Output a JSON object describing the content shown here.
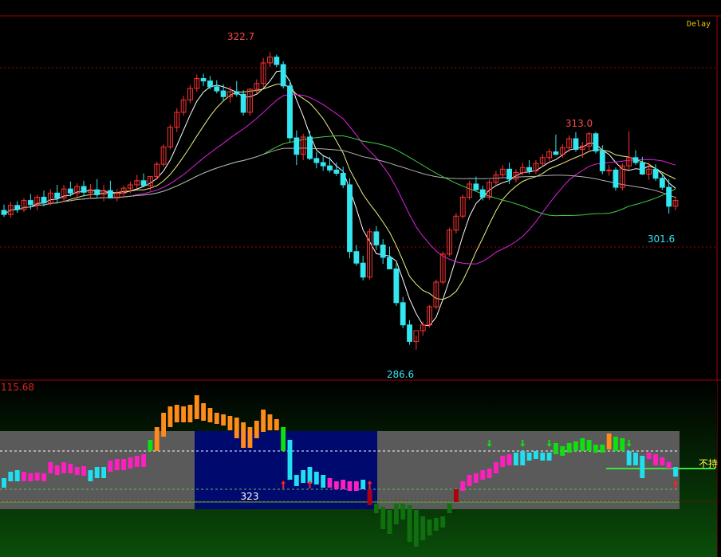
{
  "status": {
    "delay_label": "Delay"
  },
  "colors": {
    "background": "#000000",
    "frame": "#a00000",
    "grid": "#b00000",
    "up": "#ff3232",
    "down": "#33e6f0",
    "ma_white": "#ffffff",
    "ma_yellow": "#f0f080",
    "ma_magenta": "#e020e0",
    "ma_green": "#40d040",
    "ma_gray": "#b0b0b0",
    "ind_orange": "#ff8c1a",
    "ind_magenta": "#ff1fbf",
    "ind_cyan": "#20e0f0",
    "ind_green": "#10e010",
    "ind_darkgreen": "#107010",
    "ind_red": "#b00010",
    "band_gray": "#5a5a5a",
    "band_navy": "#000a6e",
    "label_yellow": "#ffff40"
  },
  "price_panel": {
    "high_label": "322.7",
    "low_label": "286.6",
    "local_high_label": "313.0",
    "last_low_label": "301.6",
    "y_range": [
      283,
      327
    ]
  },
  "indicator_panel": {
    "top_value_label": "115.68",
    "band_value_label": "323",
    "side_label": "不持"
  },
  "chart_data": {
    "type": "candlestick",
    "ylim": [
      283,
      327
    ],
    "candles": [
      [
        303.5,
        304.2,
        302.7,
        303.0
      ],
      [
        303.0,
        304.5,
        302.6,
        304.1
      ],
      [
        304.1,
        304.6,
        303.2,
        303.6
      ],
      [
        303.6,
        305.0,
        303.3,
        304.7
      ],
      [
        304.7,
        305.5,
        303.6,
        304.2
      ],
      [
        304.2,
        305.4,
        303.5,
        305.1
      ],
      [
        305.1,
        305.9,
        304.0,
        304.4
      ],
      [
        304.4,
        306.1,
        304.1,
        305.6
      ],
      [
        305.6,
        306.6,
        304.4,
        305.0
      ],
      [
        305.0,
        306.6,
        304.5,
        306.1
      ],
      [
        306.1,
        307.0,
        305.2,
        305.6
      ],
      [
        305.6,
        306.8,
        304.9,
        306.4
      ],
      [
        306.4,
        307.1,
        305.2,
        305.7
      ],
      [
        305.7,
        306.7,
        305.0,
        306.0
      ],
      [
        306.0,
        307.3,
        305.0,
        305.4
      ],
      [
        305.4,
        306.6,
        304.6,
        305.9
      ],
      [
        305.9,
        307.1,
        305.2,
        305.0
      ],
      [
        305.0,
        306.1,
        304.6,
        305.6
      ],
      [
        305.6,
        306.5,
        305.0,
        306.2
      ],
      [
        306.2,
        307.0,
        305.6,
        306.6
      ],
      [
        306.6,
        307.8,
        306.2,
        307.1
      ],
      [
        307.1,
        308.0,
        306.6,
        306.5
      ],
      [
        306.5,
        307.6,
        305.9,
        307.6
      ],
      [
        307.6,
        309.4,
        307.2,
        309.1
      ],
      [
        309.1,
        311.5,
        308.8,
        311.2
      ],
      [
        311.2,
        313.9,
        310.9,
        313.6
      ],
      [
        313.6,
        315.9,
        313.0,
        315.4
      ],
      [
        315.4,
        317.4,
        315.0,
        316.9
      ],
      [
        316.9,
        318.7,
        316.5,
        318.3
      ],
      [
        318.3,
        320.0,
        317.9,
        319.5
      ],
      [
        319.5,
        320.1,
        318.6,
        319.2
      ],
      [
        319.2,
        319.8,
        318.2,
        318.5
      ],
      [
        318.5,
        319.3,
        317.7,
        318.0
      ],
      [
        318.0,
        318.8,
        316.8,
        317.3
      ],
      [
        317.3,
        318.5,
        316.6,
        317.9
      ],
      [
        317.9,
        319.2,
        317.3,
        317.6
      ],
      [
        317.6,
        318.1,
        315.0,
        315.4
      ],
      [
        315.4,
        318.3,
        315.0,
        318.2
      ],
      [
        318.2,
        319.4,
        317.7,
        318.9
      ],
      [
        318.9,
        322.0,
        318.5,
        321.4
      ],
      [
        321.4,
        322.7,
        320.9,
        322.1
      ],
      [
        322.1,
        322.4,
        320.9,
        321.2
      ],
      [
        321.2,
        321.6,
        318.3,
        318.6
      ],
      [
        318.6,
        319.3,
        311.7,
        312.3
      ],
      [
        312.3,
        313.2,
        309.0,
        310.3
      ],
      [
        310.3,
        312.8,
        309.6,
        312.4
      ],
      [
        312.4,
        313.2,
        309.6,
        309.8
      ],
      [
        309.8,
        310.6,
        308.6,
        309.3
      ],
      [
        309.3,
        310.1,
        308.3,
        308.9
      ],
      [
        308.9,
        310.0,
        308.1,
        308.4
      ],
      [
        308.4,
        309.3,
        307.7,
        308.0
      ],
      [
        308.0,
        308.8,
        306.2,
        306.6
      ],
      [
        306.6,
        307.4,
        297.7,
        298.5
      ],
      [
        298.5,
        299.3,
        296.8,
        297.1
      ],
      [
        297.1,
        298.0,
        295.0,
        295.4
      ],
      [
        295.4,
        301.3,
        295.1,
        300.9
      ],
      [
        300.9,
        301.6,
        298.7,
        299.3
      ],
      [
        299.3,
        300.0,
        297.0,
        297.8
      ],
      [
        297.8,
        299.1,
        296.4,
        296.4
      ],
      [
        296.4,
        297.1,
        291.9,
        292.3
      ],
      [
        292.3,
        293.0,
        289.2,
        289.6
      ],
      [
        289.6,
        290.2,
        287.2,
        287.6
      ],
      [
        287.6,
        288.3,
        286.6,
        288.9
      ],
      [
        288.9,
        290.0,
        288.3,
        289.6
      ],
      [
        289.6,
        292.0,
        289.3,
        291.8
      ],
      [
        291.8,
        295.1,
        291.5,
        294.8
      ],
      [
        294.8,
        298.5,
        294.5,
        298.2
      ],
      [
        298.2,
        301.4,
        297.9,
        301.1
      ],
      [
        301.1,
        303.2,
        300.7,
        302.8
      ],
      [
        302.8,
        305.4,
        302.5,
        305.1
      ],
      [
        305.1,
        307.1,
        304.8,
        306.7
      ],
      [
        306.7,
        307.6,
        305.9,
        306.0
      ],
      [
        306.0,
        306.5,
        304.7,
        305.1
      ],
      [
        305.1,
        307.2,
        304.8,
        306.9
      ],
      [
        306.9,
        308.3,
        306.5,
        307.8
      ],
      [
        307.8,
        309.0,
        307.4,
        308.5
      ],
      [
        308.5,
        309.3,
        306.7,
        307.3
      ],
      [
        307.3,
        308.5,
        306.9,
        308.1
      ],
      [
        308.1,
        309.3,
        307.8,
        308.7
      ],
      [
        308.7,
        309.6,
        307.9,
        308.3
      ],
      [
        308.3,
        309.6,
        307.9,
        309.2
      ],
      [
        309.2,
        310.3,
        308.8,
        309.9
      ],
      [
        309.9,
        311.0,
        309.5,
        310.6
      ],
      [
        310.6,
        312.7,
        310.2,
        310.3
      ],
      [
        310.3,
        311.5,
        309.9,
        311.1
      ],
      [
        311.1,
        312.6,
        310.6,
        312.2
      ],
      [
        312.2,
        313.0,
        310.6,
        310.9
      ],
      [
        310.9,
        311.8,
        309.9,
        311.3
      ],
      [
        311.3,
        313.0,
        310.8,
        312.8
      ],
      [
        312.8,
        313.0,
        310.4,
        310.7
      ],
      [
        310.7,
        311.4,
        307.9,
        308.3
      ],
      [
        308.3,
        309.0,
        307.7,
        308.4
      ],
      [
        308.4,
        308.7,
        305.9,
        306.3
      ],
      [
        306.3,
        309.2,
        305.9,
        308.9
      ],
      [
        308.9,
        313.1,
        308.5,
        309.9
      ],
      [
        309.9,
        310.8,
        309.0,
        309.3
      ],
      [
        309.3,
        310.0,
        307.8,
        307.9
      ],
      [
        307.9,
        309.3,
        307.2,
        308.5
      ],
      [
        308.5,
        309.1,
        307.1,
        307.4
      ],
      [
        307.4,
        308.0,
        306.0,
        306.3
      ],
      [
        306.3,
        307.3,
        303.1,
        304.0
      ],
      [
        304.0,
        305.2,
        303.5,
        304.7
      ]
    ]
  }
}
